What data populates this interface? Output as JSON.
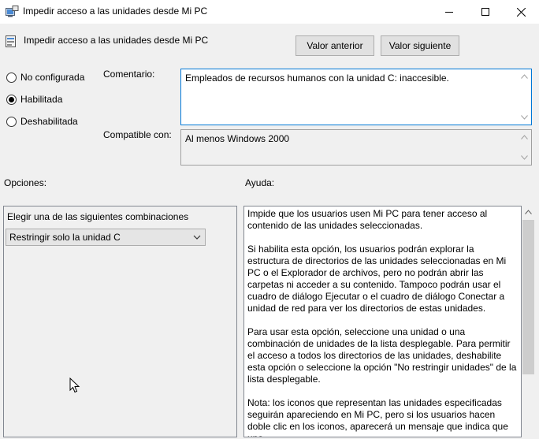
{
  "window": {
    "title": "Impedir acceso a las unidades desde Mi PC",
    "controls": {
      "minimize": "minimize-icon",
      "maximize": "maximize-icon",
      "close": "close-icon"
    }
  },
  "header": {
    "policy_name": "Impedir acceso a las unidades desde Mi PC",
    "prev_button": "Valor anterior",
    "next_button": "Valor siguiente"
  },
  "state": {
    "options": [
      {
        "label": "No configurada",
        "checked": false
      },
      {
        "label": "Habilitada",
        "checked": true
      },
      {
        "label": "Deshabilitada",
        "checked": false
      }
    ]
  },
  "comment": {
    "label": "Comentario:",
    "value": "Empleados de recursos humanos con la unidad C: inaccesible."
  },
  "compatible": {
    "label": "Compatible con:",
    "value": "Al menos Windows 2000"
  },
  "options_section": {
    "label": "Opciones:",
    "choose_label": "Elegir una de las siguientes combinaciones",
    "selected": "Restringir solo la unidad C"
  },
  "help_section": {
    "label": "Ayuda:",
    "paragraphs": [
      "Impide que los usuarios usen Mi PC para tener acceso al contenido de las unidades seleccionadas.",
      "Si habilita esta opción, los usuarios podrán explorar la estructura de directorios de las unidades seleccionadas en Mi PC o el Explorador de archivos, pero no podrán abrir las carpetas ni acceder a su contenido. Tampoco podrán usar el cuadro de diálogo Ejecutar o el cuadro de diálogo Conectar a unidad de red para ver los directorios de estas unidades.",
      "Para usar esta opción, seleccione una unidad o una combinación de unidades de la lista desplegable. Para permitir el acceso a todos los directorios de las unidades, deshabilite esta opción o seleccione la opción \"No restringir unidades\" de la lista desplegable.",
      "Nota: los iconos que representan las unidades especificadas seguirán apareciendo en Mi PC, pero si los usuarios hacen doble clic en los iconos, aparecerá un mensaje que indica que una"
    ]
  },
  "colors": {
    "focus_border": "#0078d7",
    "button_face": "#e1e1e1",
    "dialog_bg": "#f0f0f0"
  }
}
